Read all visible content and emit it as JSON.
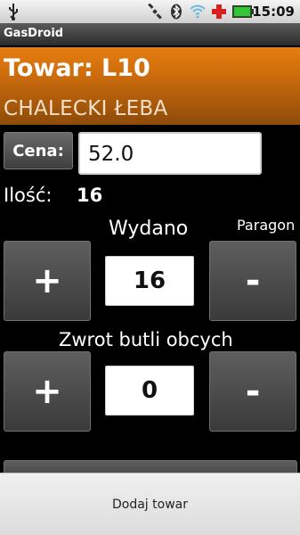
{
  "status_bar": {
    "time": "15:09",
    "icons": [
      "usb-icon",
      "satellite-icon",
      "bluetooth-icon",
      "wifi-icon",
      "health-cross-icon",
      "battery-icon"
    ]
  },
  "app": {
    "title": "GasDroid"
  },
  "header": {
    "towar": "Towar: L10",
    "name": "CHALECKI ŁEBA"
  },
  "price": {
    "button_label": "Cena:",
    "value": "52.0"
  },
  "quantity": {
    "label": "Ilość:",
    "value": "16"
  },
  "wydano": {
    "label": "Wydano",
    "plus": "+",
    "value": "16",
    "minus": "-"
  },
  "paragon": {
    "label": "Paragon"
  },
  "zwrot": {
    "label": "Zwrot butli obcych",
    "plus": "+",
    "value": "0",
    "minus": "-"
  },
  "footer": {
    "action_label": "Dodaj towar"
  },
  "colors": {
    "header_orange": "#d9740e",
    "title_bar": "#3a3a3a",
    "button": "#4a4a4a"
  }
}
